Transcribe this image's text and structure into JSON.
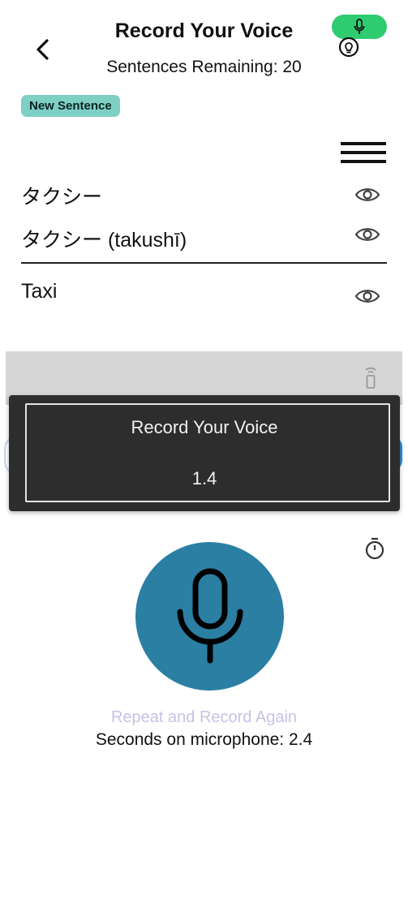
{
  "header": {
    "title": "Record Your Voice",
    "sentences_remaining": "Sentences Remaining: 20",
    "back_icon": "chevron-left-icon",
    "mic_indicator_icon": "microphone-icon",
    "mic_indicator_color": "#2ecc71",
    "hint_icon": "lightbulb-icon"
  },
  "new_sentence_button": "New Sentence",
  "menu_icon": "hamburger-menu-icon",
  "sentences": [
    {
      "text": "タクシー",
      "icon": "eye-icon"
    },
    {
      "text": "タクシー (takushī)",
      "icon": "eye-icon"
    },
    {
      "text": "Taxi",
      "icon": "eye-icon"
    }
  ],
  "recording_panel": {
    "title": "Record Your Voice",
    "value": "1.4"
  },
  "record_button": {
    "icon": "microphone-icon",
    "color": "#2a7fa3"
  },
  "repeat_label": "Repeat and Record Again",
  "seconds_label": "Seconds on microphone: 2.4",
  "timer_icon": "stopwatch-icon",
  "remote_icon": "remote-control-icon"
}
